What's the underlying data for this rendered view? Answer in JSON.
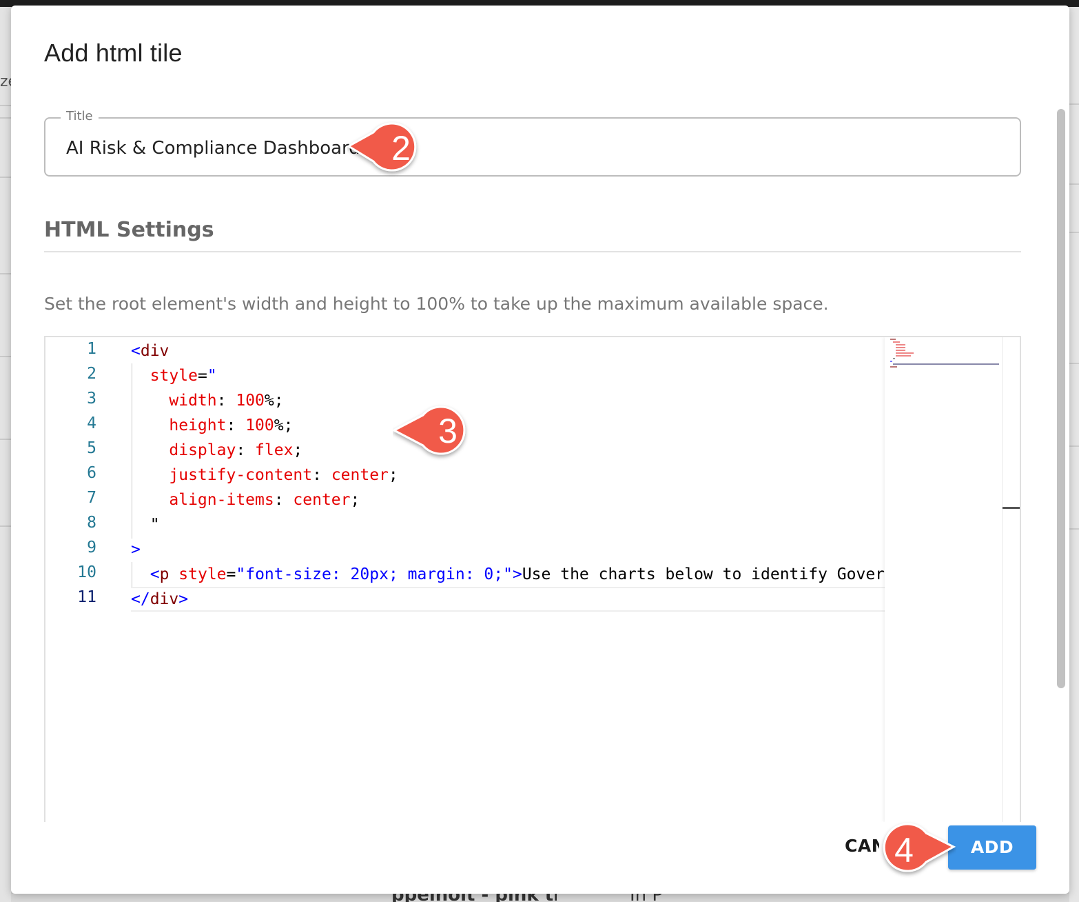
{
  "background": {
    "left_text": "ze",
    "bottom_items": [
      "ppeinoit - pink tr...",
      "In P"
    ]
  },
  "dialog": {
    "title": "Add html tile",
    "title_field": {
      "label": "Title",
      "value": "AI Risk & Compliance Dashboard"
    },
    "section_heading": "HTML Settings",
    "hint": "Set the root element's width and height to 100% to take up the maximum available space.",
    "editor": {
      "line_numbers": [
        "1",
        "2",
        "3",
        "4",
        "5",
        "6",
        "7",
        "8",
        "9",
        "10",
        "11"
      ],
      "active_line": "11"
    },
    "cancel_label": "CANCEL",
    "add_label": "ADD"
  },
  "callouts": [
    {
      "number": "2",
      "points_to": "title-field"
    },
    {
      "number": "3",
      "points_to": "code-editor"
    },
    {
      "number": "4",
      "points_to": "add-button"
    }
  ],
  "colors": {
    "accent": "#3b93e6",
    "callout": "#f15a4a",
    "line_number": "#237893"
  }
}
